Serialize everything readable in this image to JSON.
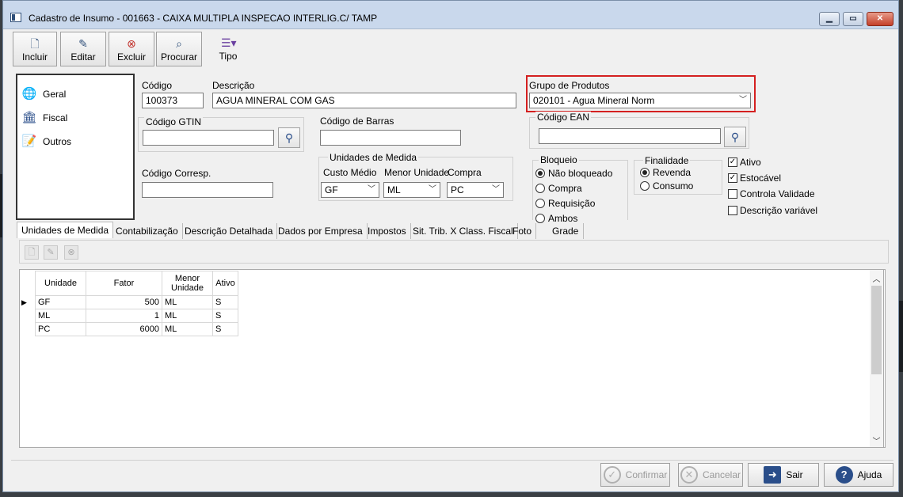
{
  "window": {
    "title": "Cadastro de Insumo - 001663 - CAIXA MULTIPLA INSPECAO INTERLIG.C/ TAMP",
    "min_glyph": "▁",
    "max_glyph": "▭",
    "close_glyph": "✕"
  },
  "toolbar": {
    "incluir": "Incluir",
    "editar": "Editar",
    "excluir": "Excluir",
    "procurar": "Procurar",
    "tipo": "Tipo"
  },
  "nav": {
    "items": [
      {
        "label": "Geral",
        "icon": "globe-icon"
      },
      {
        "label": "Fiscal",
        "icon": "bank-icon"
      },
      {
        "label": "Outros",
        "icon": "document-edit-icon"
      }
    ]
  },
  "form": {
    "codigo_label": "Código",
    "codigo_value": "100373",
    "descricao_label": "Descrição",
    "descricao_value": "AGUA MINERAL COM GAS",
    "grupo_label": "Grupo de Produtos",
    "grupo_value": "020101 - Agua Mineral Norm",
    "gtin_label": "Código GTIN",
    "gtin_value": "",
    "barras_label": "Código de Barras",
    "barras_value": "",
    "ean_label": "Código EAN",
    "ean_value": "",
    "corresp_label": "Código Corresp.",
    "corresp_value": "",
    "unidades": {
      "group_label": "Unidades de Medida",
      "custo_label": "Custo Médio",
      "custo_value": "GF",
      "menor_label": "Menor Unidade",
      "menor_value": "ML",
      "compra_label": "Compra",
      "compra_value": "PC"
    },
    "bloqueio": {
      "group_label": "Bloqueio",
      "options": [
        "Não bloqueado",
        "Compra",
        "Requisição",
        "Ambos"
      ],
      "selected": "Não bloqueado"
    },
    "finalidade": {
      "group_label": "Finalidade",
      "options": [
        "Revenda",
        "Consumo"
      ],
      "selected": "Revenda"
    },
    "checks": [
      {
        "label": "Ativo",
        "checked": true
      },
      {
        "label": "Estocável",
        "checked": true
      },
      {
        "label": "Controla Validade",
        "checked": false
      },
      {
        "label": "Descrição variável",
        "checked": false
      }
    ]
  },
  "tabs": [
    "Unidades de Medida",
    "Contabilização",
    "Descrição Detalhada",
    "Dados por Empresa",
    "Impostos",
    "Sit. Trib. X Class. Fiscal",
    "Foto",
    "Grade"
  ],
  "active_tab": "Unidades de Medida",
  "grid": {
    "headers": [
      "Unidade",
      "Fator",
      "Menor Unidade",
      "Ativo"
    ],
    "rows": [
      [
        "GF",
        "500",
        "ML",
        "S"
      ],
      [
        "ML",
        "1",
        "ML",
        "S"
      ],
      [
        "PC",
        "6000",
        "ML",
        "S"
      ]
    ]
  },
  "buttons": {
    "confirmar": "Confirmar",
    "cancelar": "Cancelar",
    "sair": "Sair",
    "ajuda": "Ajuda"
  },
  "colors": {
    "highlight": "#d42020",
    "titlebar": "#c9d8ec",
    "accent": "#2a4e8a"
  }
}
